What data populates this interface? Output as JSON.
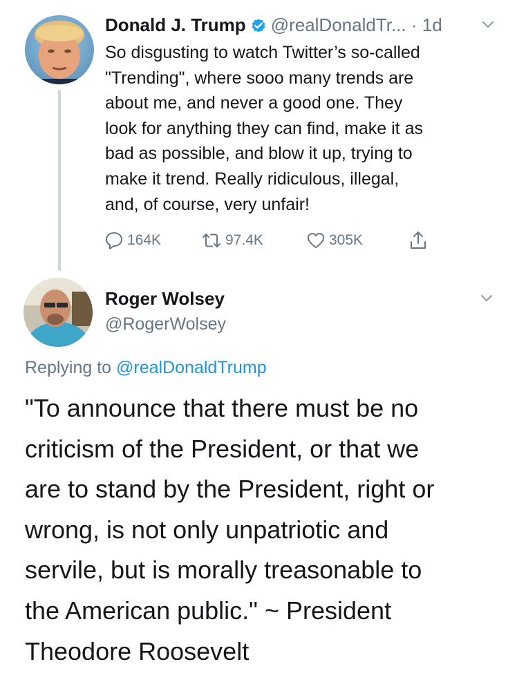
{
  "tweet": {
    "author": {
      "name": "Donald J. Trump",
      "handle": "@realDonaldTr...",
      "verified": true,
      "avatar": "avatar-trump"
    },
    "separator": "·",
    "time": "1d",
    "text_lines": [
      "So disgusting to watch Twitter’s so-called",
      "\"Trending\", where sooo many trends are",
      "about me, and never a good one. They",
      "look for anything they can find, make it as",
      "bad as possible, and blow it up, trying to",
      "make it trend. Really ridiculous, illegal,",
      "and, of course, very unfair!"
    ],
    "actions": {
      "replies": "164K",
      "retweets": "97.4K",
      "likes": "305K"
    },
    "icons": [
      "verified-badge-icon",
      "chevron-down-icon",
      "reply-icon",
      "retweet-icon",
      "heart-icon",
      "share-icon"
    ]
  },
  "reply": {
    "author": {
      "name": "Roger Wolsey",
      "handle": "@RogerWolsey",
      "avatar": "avatar-roger"
    },
    "replying_prefix": "Replying to",
    "replying_handle": "@realDonaldTrump",
    "text_lines": [
      "\"To announce that there must be no",
      "criticism of the President, or that we",
      "are to stand by the President, right or",
      "wrong, is not only unpatriotic and",
      "servile, but is morally treasonable to",
      "the American public.\" ~ President",
      "Theodore Roosevelt"
    ]
  },
  "colors": {
    "text": "#14171a",
    "secondary": "#657786",
    "link": "#1b95e0",
    "verified": "#1da1f2",
    "thread_line": "#ccd6dd"
  }
}
